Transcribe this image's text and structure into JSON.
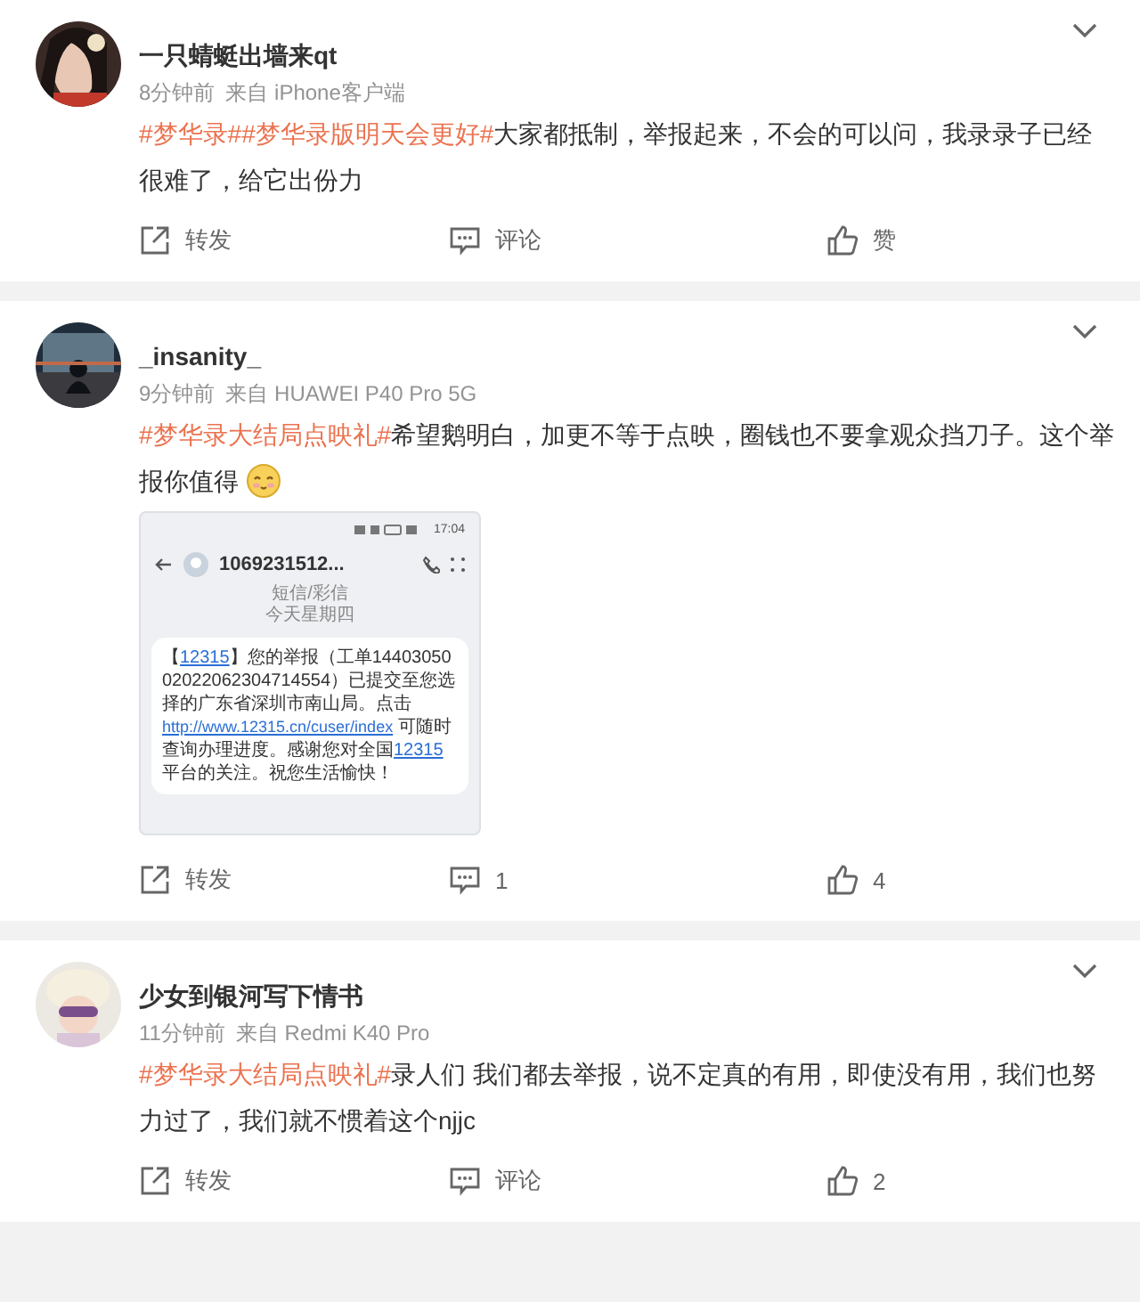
{
  "posts": [
    {
      "name": "一只蜻蜓出墙来qt",
      "time": "8分钟前",
      "source": "来自 iPhone客户端",
      "body": [
        {
          "kind": "topic",
          "text": "#梦华录#"
        },
        {
          "kind": "topic",
          "text": "#梦华录版明天会更好#"
        },
        {
          "kind": "text",
          "text": "大家都抵制，举报起来，不会的可以问，我录录子已经很难了，给它出份力"
        }
      ],
      "actions": [
        {
          "kind": "repost",
          "label": "转发"
        },
        {
          "kind": "comment",
          "label": "评论"
        },
        {
          "kind": "like",
          "label": "赞"
        }
      ]
    },
    {
      "name": "_insanity_",
      "time": "9分钟前",
      "source": "来自 HUAWEI P40 Pro 5G",
      "body": [
        {
          "kind": "topic",
          "text": "#梦华录大结局点映礼#"
        },
        {
          "kind": "text",
          "text": "希望鹅明白，加更不等于点映，圈钱也不要拿观众挡刀子。这个举报你值得"
        },
        {
          "kind": "emoji"
        }
      ],
      "image": {
        "status_time": "17:04",
        "contact": "1069231512...",
        "header": [
          "短信/彩信",
          "今天星期四"
        ],
        "message": [
          {
            "kind": "text",
            "text": "【"
          },
          {
            "kind": "link",
            "text": "12315"
          },
          {
            "kind": "text",
            "text": "】您的举报（工单1440305002022062304714554）已提交至您选择的广东省深圳市南山局。点击 "
          },
          {
            "kind": "link",
            "text": "http://www.12315.cn/cuser/index"
          },
          {
            "kind": "text",
            "text": " 可随时查询办理进度。感谢您对全国"
          },
          {
            "kind": "link",
            "text": "12315"
          },
          {
            "kind": "text",
            "text": "平台的关注。祝您生活愉快！"
          }
        ]
      },
      "actions": [
        {
          "kind": "repost",
          "label": "转发"
        },
        {
          "kind": "comment",
          "label": "1"
        },
        {
          "kind": "like",
          "label": "4"
        }
      ]
    },
    {
      "name": "少女到银河写下情书",
      "time": "11分钟前",
      "source": "来自 Redmi K40 Pro",
      "body": [
        {
          "kind": "topic",
          "text": "#梦华录大结局点映礼#"
        },
        {
          "kind": "text",
          "text": "录人们 我们都去举报，说不定真的有用，即使没有用，我们也努力过了，我们就不惯着这个njjc"
        }
      ],
      "actions": [
        {
          "kind": "repost",
          "label": "转发"
        },
        {
          "kind": "comment",
          "label": "评论"
        },
        {
          "kind": "like",
          "label": "2"
        }
      ]
    }
  ]
}
